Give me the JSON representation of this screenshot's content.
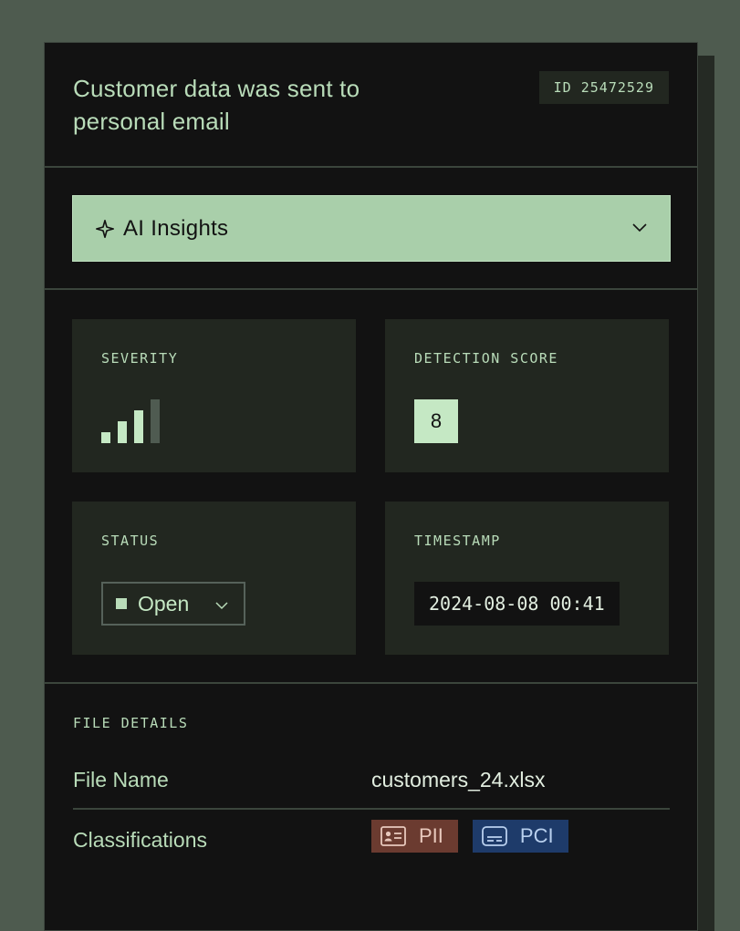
{
  "header": {
    "title": "Customer data was sent to personal email",
    "id_label": "ID 25472529"
  },
  "insights": {
    "label": "AI Insights",
    "icon": "sparkle-icon",
    "expand_icon": "chevron-down-icon"
  },
  "severity": {
    "label": "SEVERITY",
    "level": 3,
    "max": 4
  },
  "detection": {
    "label": "DETECTION SCORE",
    "score": "8"
  },
  "status": {
    "label": "STATUS",
    "value": "Open"
  },
  "timestamp": {
    "label": "TIMESTAMP",
    "value": "2024-08-08 00:41"
  },
  "file_details": {
    "heading": "FILE DETAILS",
    "file_name_label": "File Name",
    "file_name": "customers_24.xlsx",
    "classifications_label": "Classifications",
    "classifications": [
      {
        "label": "PII",
        "icon": "id-card-icon",
        "color": "#6b3b30"
      },
      {
        "label": "PCI",
        "icon": "credit-card-icon",
        "color": "#1e3b6a"
      }
    ]
  },
  "colors": {
    "accent": "#a9cfaa",
    "background": "#121212",
    "tile": "#222720"
  }
}
